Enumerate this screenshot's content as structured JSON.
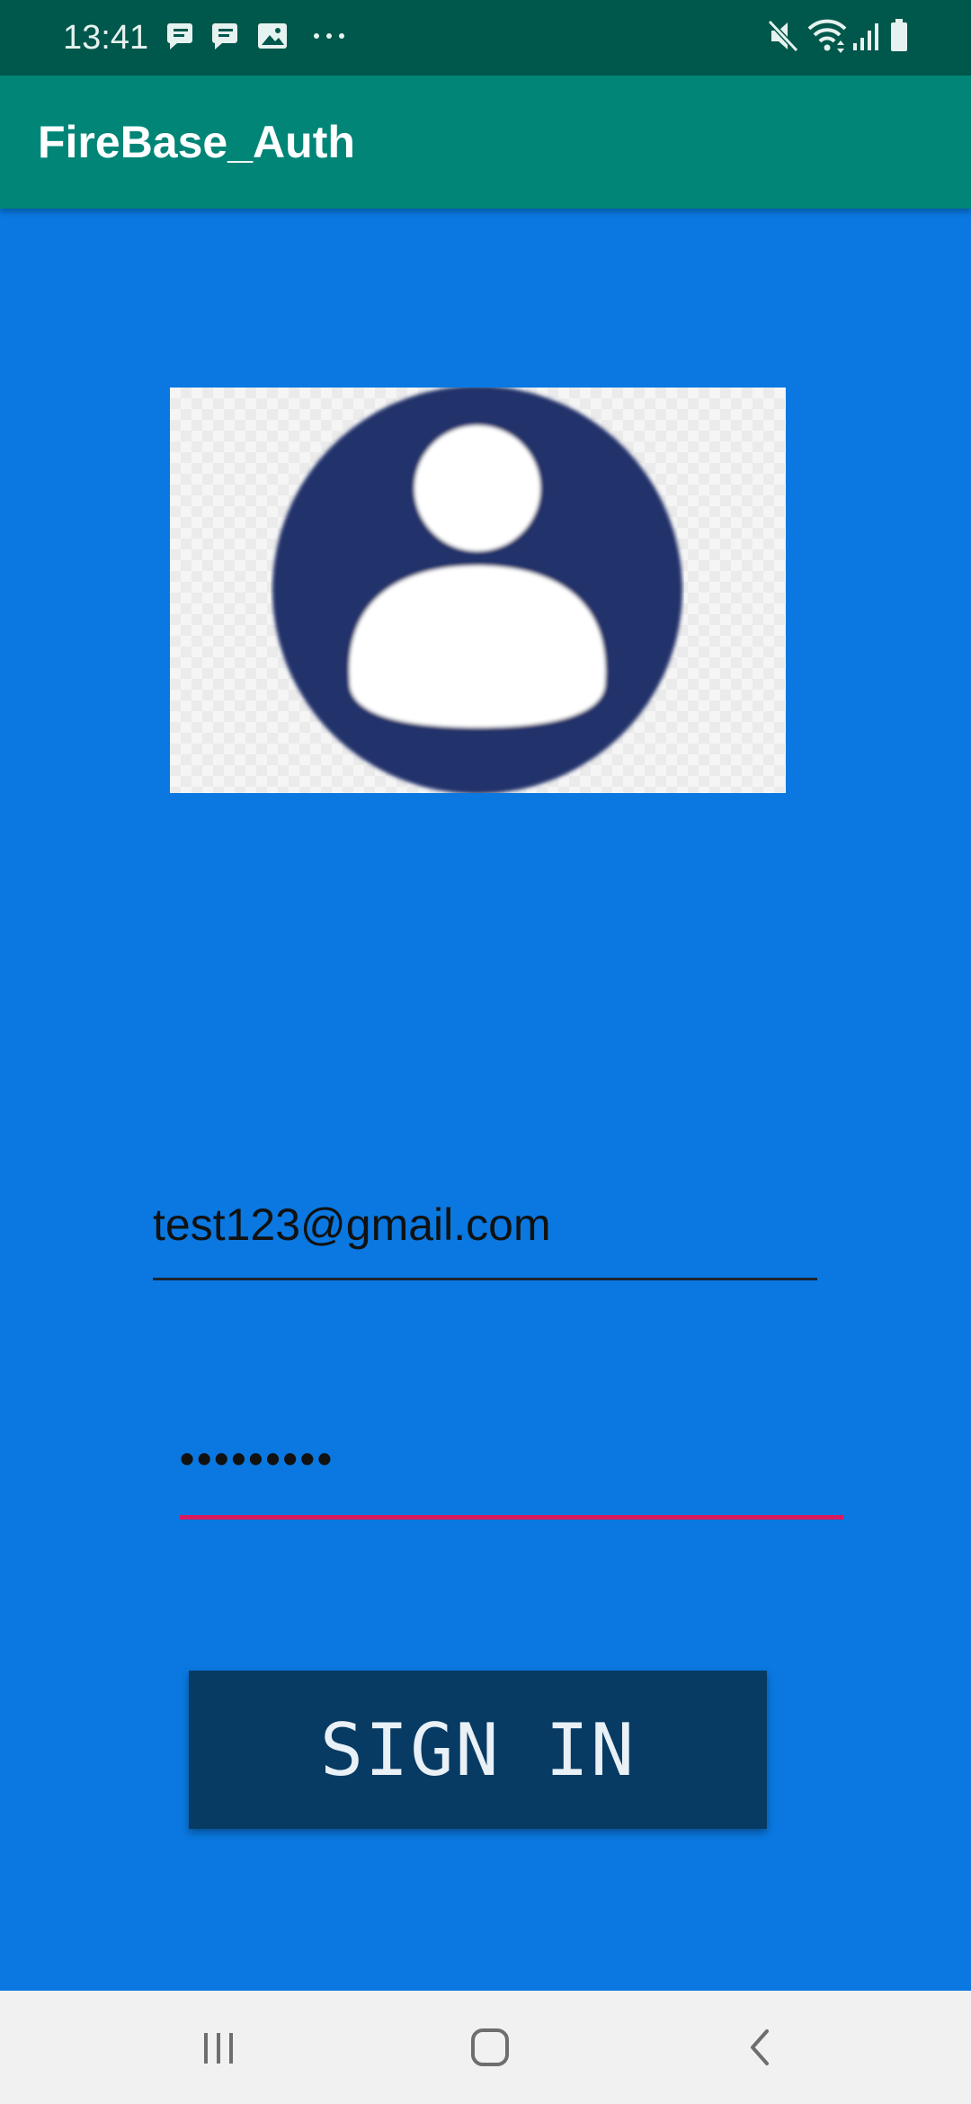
{
  "status_bar": {
    "time": "13:41",
    "notification_icons": [
      "chat-icon",
      "chat-icon",
      "image-icon",
      "more-icon"
    ],
    "system_icons": [
      "mute-icon",
      "wifi-icon",
      "signal-icon",
      "battery-icon"
    ]
  },
  "app_bar": {
    "title": "FireBase_Auth",
    "color": "#008577"
  },
  "avatar": {
    "icon": "user-avatar-icon",
    "color": "#21306a"
  },
  "form": {
    "email_value": "test123@gmail.com",
    "password_value": "•••••••••",
    "password_accent": "#d81b60"
  },
  "sign_in_button": {
    "label": "SIGN IN",
    "color": "#073b63"
  },
  "background_color": "#0a78e0",
  "nav_bar": {
    "buttons": [
      "recent-apps-icon",
      "home-icon",
      "back-icon"
    ]
  }
}
